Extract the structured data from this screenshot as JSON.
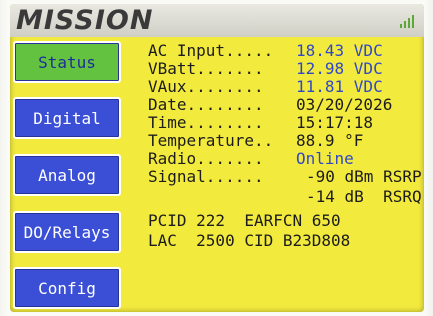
{
  "header": {
    "logo": "MISSION"
  },
  "nav": {
    "status": "Status",
    "digital": "Digital",
    "analog": "Analog",
    "relays": "DO/Relays",
    "config": "Config"
  },
  "rows": {
    "ac_label": "AC Input.....",
    "ac_value": "18.43 VDC",
    "vbatt_label": "VBatt.......",
    "vbatt_value": "12.98 VDC",
    "vaux_label": "VAux........",
    "vaux_value": "11.81 VDC",
    "date_label": "Date........",
    "date_value": "03/20/2026",
    "time_label": "Time........",
    "time_value": "15:17:18",
    "temp_label": "Temperature..",
    "temp_value": "88.9 °F",
    "radio_label": "Radio.......",
    "radio_value": "Online",
    "signal_label": "Signal......",
    "rsrp_value": "-90 dBm RSRP",
    "rsrq_value": "-14 dB  RSRQ",
    "pcid_line": "PCID 222  EARFCN 650",
    "lac_line": "LAC  2500 CID B23D808"
  },
  "colors": {
    "screen": "#f3ea3e",
    "button": "#3a4fd6",
    "active_button": "#63c340",
    "value_text": "#3048c8"
  },
  "icons": {
    "signal": "signal-bars-icon"
  }
}
